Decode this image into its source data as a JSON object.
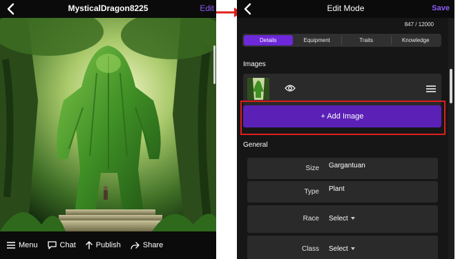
{
  "left_screen": {
    "title": "MysticalDragon8225",
    "edit_label": "Edit",
    "footer": {
      "menu_label": "Menu",
      "chat_label": "Chat",
      "publish_label": "Publish",
      "share_label": "Share"
    },
    "image_icon": "forest-giant-artwork"
  },
  "right_screen": {
    "title": "Edit Mode",
    "save_label": "Save",
    "char_count": "847 / 12000",
    "tabs": [
      {
        "label": "Details",
        "active": true
      },
      {
        "label": "Equipment",
        "active": false
      },
      {
        "label": "Traits",
        "active": false
      },
      {
        "label": "Knowledge",
        "active": false
      }
    ],
    "images_label": "Images",
    "add_image_label": "+ Add Image",
    "general_label": "General",
    "fields": [
      {
        "label": "Size",
        "value": "Gargantuan"
      },
      {
        "label": "Type",
        "value": "Plant"
      },
      {
        "label": "Race",
        "value": "Select"
      },
      {
        "label": "Class",
        "value": "Select"
      }
    ]
  },
  "colors": {
    "accent": "#8b5cf6",
    "button_purple": "#5b21b6",
    "highlight_red": "#e11d1d"
  }
}
